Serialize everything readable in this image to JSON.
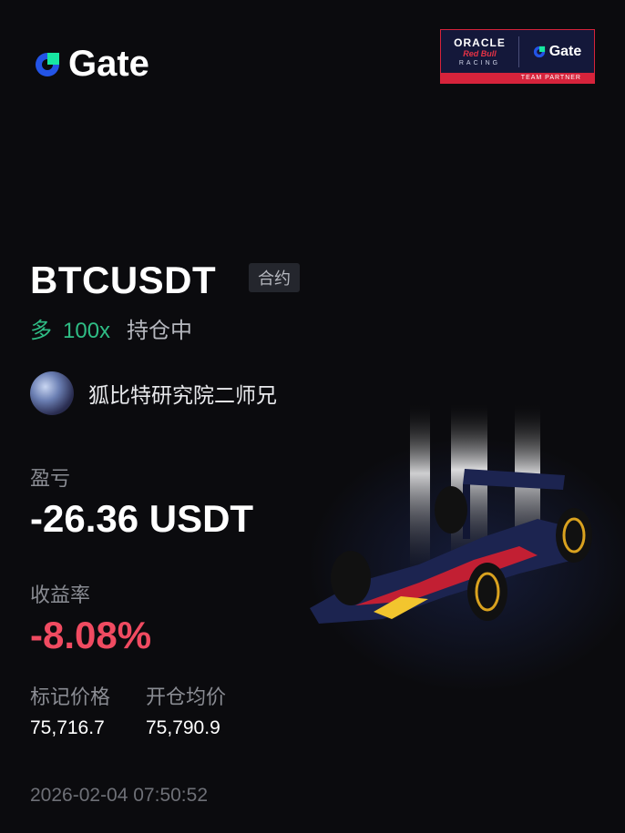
{
  "brand": {
    "name": "Gate"
  },
  "partner": {
    "line1": "ORACLE",
    "line2": "Red Bull",
    "line3": "RACING",
    "brand": "Gate",
    "footer": "TEAM PARTNER"
  },
  "position": {
    "pair": "BTCUSDT",
    "type_tag": "合约",
    "side": "多",
    "leverage": "100x",
    "status": "持仓中"
  },
  "user": {
    "name": "狐比特研究院二师兄"
  },
  "pnl": {
    "label": "盈亏",
    "value": "-26.36 USDT"
  },
  "return_rate": {
    "label": "收益率",
    "value": "-8.08%"
  },
  "prices": {
    "mark_label": "标记价格",
    "mark_value": "75,716.7",
    "entry_label": "开仓均价",
    "entry_value": "75,790.9"
  },
  "timestamp": "2026-02-04 07:50:52",
  "colors": {
    "background": "#0b0b0e",
    "long_green": "#2fbd85",
    "loss_red": "#f04b61",
    "muted_text": "#8a8c93",
    "brand_blue": "#2354e6",
    "brand_green": "#17e6a1"
  }
}
